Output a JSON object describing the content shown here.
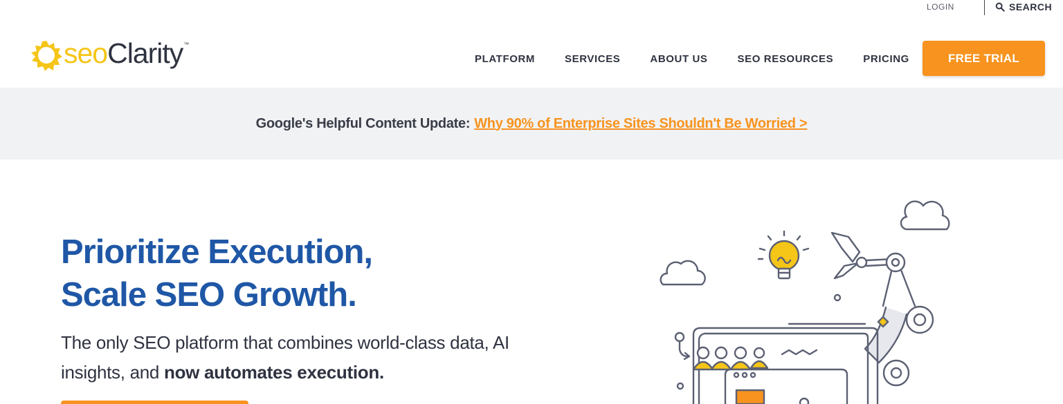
{
  "utility": {
    "login_label": "LOGIN",
    "search_label": "SEARCH"
  },
  "logo": {
    "seo": "seo",
    "clarity": "Clarity",
    "tm": "™"
  },
  "nav": {
    "items": [
      {
        "label": "PLATFORM"
      },
      {
        "label": "SERVICES"
      },
      {
        "label": "ABOUT US"
      },
      {
        "label": "SEO RESOURCES"
      },
      {
        "label": "PRICING"
      }
    ],
    "cta_label": "FREE TRIAL"
  },
  "announcement": {
    "lead": "Google's Helpful Content Update:",
    "link": "Why 90% of Enterprise Sites Shouldn't Be Worried >"
  },
  "hero": {
    "title_line1": "Prioritize Execution,",
    "title_line2": "Scale SEO Growth.",
    "subtitle_start": "The only SEO platform that combines world-class data, AI insights, and ",
    "subtitle_bold": "now automates execution."
  },
  "colors": {
    "accent_orange": "#f7931e",
    "brand_yellow": "#f5c518",
    "hero_blue": "#1f57a6",
    "banner_bg": "#f1f2f4"
  },
  "icons": {
    "search": "search-icon",
    "logo": "sun-logo-icon",
    "illustration": "robot-arm-illustration"
  }
}
